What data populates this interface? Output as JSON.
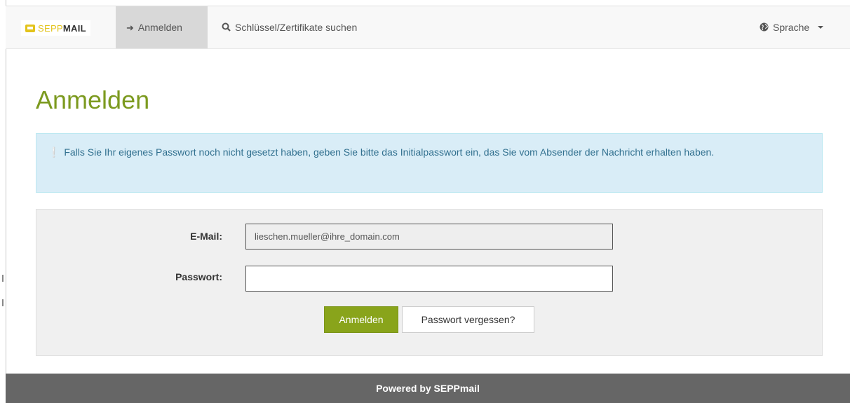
{
  "navbar": {
    "brand": {
      "part1": "SEPP",
      "part2": "MAIL"
    },
    "login": {
      "icon": "sign-in-icon",
      "label": "Anmelden"
    },
    "search": {
      "icon": "search-icon",
      "label": "Schlüssel/Zertifikate suchen"
    },
    "language": {
      "icon": "globe-icon",
      "label": "Sprache"
    }
  },
  "page": {
    "title": "Anmelden"
  },
  "alert": {
    "icon": "info-icon",
    "text": "Falls Sie Ihr eigenes Passwort noch nicht gesetzt haben, geben Sie bitte das Initialpasswort ein, das Sie vom Absender der Nachricht erhalten haben."
  },
  "form": {
    "email_label": "E-Mail:",
    "email_value": "lieschen.mueller@ihre_domain.com",
    "password_label": "Passwort:",
    "password_value": "",
    "submit_label": "Anmelden",
    "forgot_label": "Passwort vergessen?"
  },
  "footer": {
    "text": "Powered by SEPPmail"
  },
  "colors": {
    "accent": "#7c9a1f",
    "button": "#89a41b",
    "logo": "#e3c31b",
    "alert_bg": "#d9edf7",
    "alert_text": "#31708f",
    "footer_bg": "#666666"
  }
}
